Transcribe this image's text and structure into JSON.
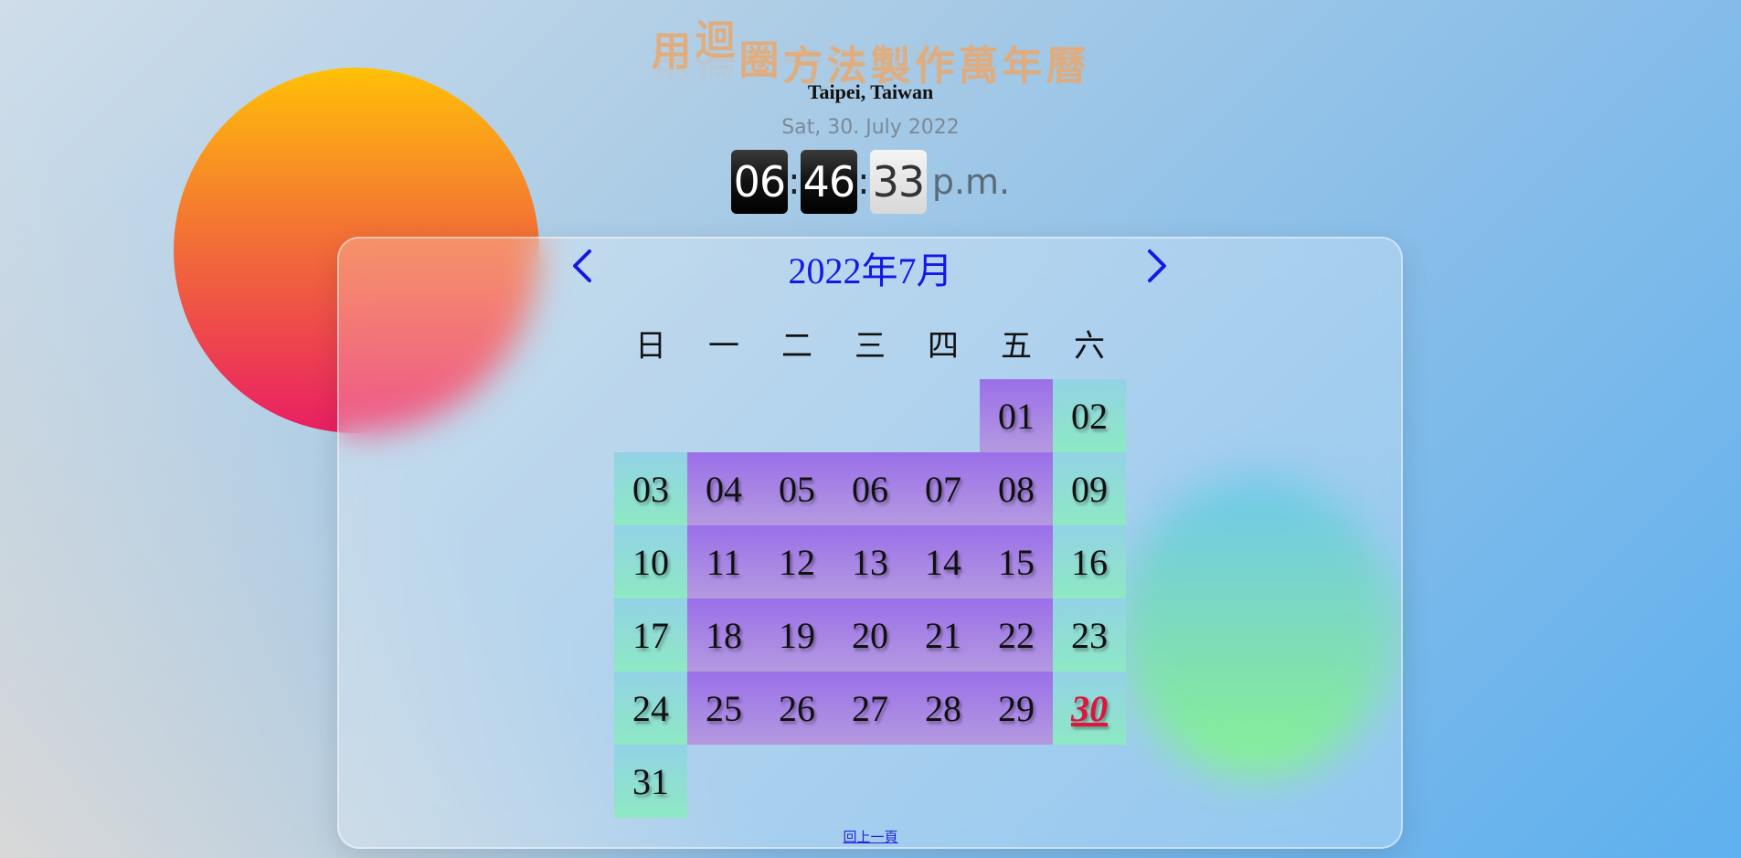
{
  "header": {
    "title_chars": [
      "用",
      "迴",
      "圈",
      "方",
      "法",
      "製",
      "作",
      "萬",
      "年",
      "曆"
    ],
    "location": "Taipei, Taiwan",
    "date": "Sat, 30. July 2022"
  },
  "clock": {
    "hours": "06",
    "minutes": "46",
    "seconds": "33",
    "separator": ":",
    "ampm": "p.m."
  },
  "calendar": {
    "title": "2022年7月",
    "prev_icon": "chevron-left-icon",
    "next_icon": "chevron-right-icon",
    "weekdays": [
      "日",
      "一",
      "二",
      "三",
      "四",
      "五",
      "六"
    ],
    "weeks": [
      [
        "",
        "",
        "",
        "",
        "",
        "01",
        "02"
      ],
      [
        "03",
        "04",
        "05",
        "06",
        "07",
        "08",
        "09"
      ],
      [
        "10",
        "11",
        "12",
        "13",
        "14",
        "15",
        "16"
      ],
      [
        "17",
        "18",
        "19",
        "20",
        "21",
        "22",
        "23"
      ],
      [
        "24",
        "25",
        "26",
        "27",
        "28",
        "29",
        "30"
      ],
      [
        "31",
        "",
        "",
        "",
        "",
        "",
        ""
      ]
    ],
    "today": "30"
  },
  "footer": {
    "back_link": "回上一頁"
  },
  "colors": {
    "nav_arrow": "#1717e6",
    "today": "#e0143c"
  }
}
